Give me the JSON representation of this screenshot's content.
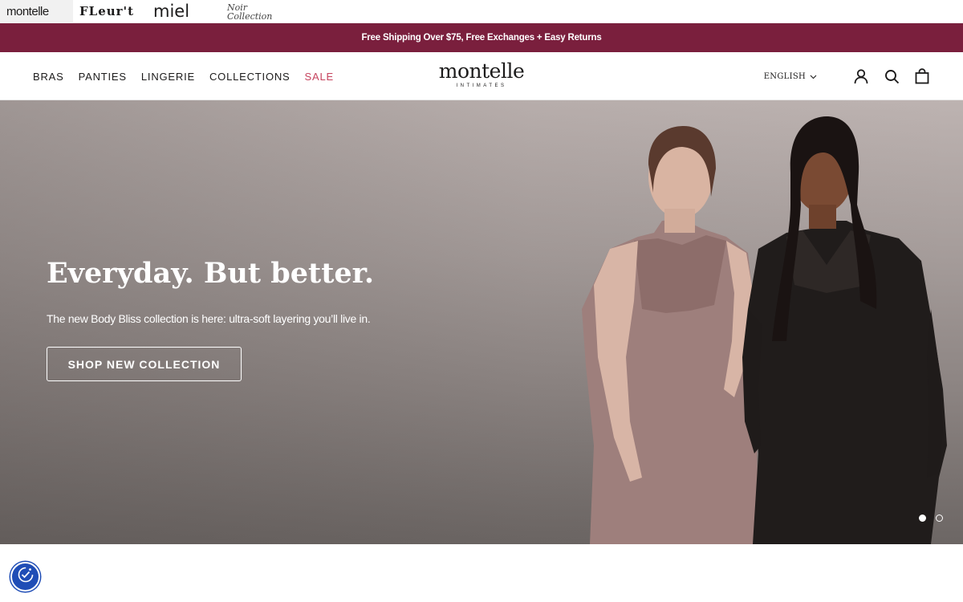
{
  "brands": [
    {
      "label": "montelle",
      "active": true
    },
    {
      "label": "FLeur't",
      "active": false
    },
    {
      "label": "miel",
      "active": false
    },
    {
      "label": "Noir Collection",
      "active": false
    }
  ],
  "announcement": "Free Shipping Over $75, Free Exchanges + Easy Returns",
  "nav": {
    "items": [
      "BRAS",
      "PANTIES",
      "LINGERIE",
      "COLLECTIONS",
      "SALE"
    ],
    "sale_color": "#c6435e"
  },
  "logo": {
    "main": "montelle",
    "sub": "INTIMATES"
  },
  "language": "ENGLISH",
  "icons": {
    "account": "user-icon",
    "search": "search-icon",
    "cart": "shopping-bag-icon",
    "lang_chevron": "chevron-down-icon",
    "a11y": "accessibility-icon"
  },
  "hero": {
    "title": "Everyday. But better.",
    "subtitle": "The new Body Bliss collection is here: ultra-soft layering you’ll live in.",
    "cta": "SHOP NEW COLLECTION",
    "slides": 2,
    "active_slide": 1
  },
  "colors": {
    "announcement_bg": "#7a1f3d",
    "a11y_bg": "#1f4db6"
  }
}
